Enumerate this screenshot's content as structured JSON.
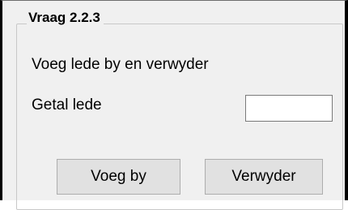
{
  "groupbox": {
    "title": "Vraag 2.2.3"
  },
  "form": {
    "description": "Voeg lede by en verwyder",
    "count_label": "Getal lede",
    "count_value": ""
  },
  "buttons": {
    "add_label": "Voeg by",
    "remove_label": "Verwyder"
  }
}
